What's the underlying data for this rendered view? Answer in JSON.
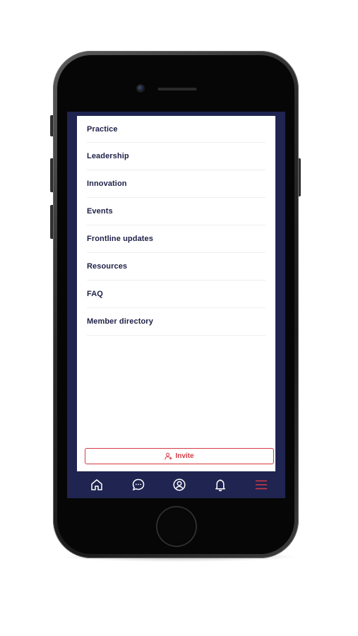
{
  "menu": {
    "items": [
      {
        "label": "Practice"
      },
      {
        "label": "Leadership"
      },
      {
        "label": "Innovation"
      },
      {
        "label": "Events"
      },
      {
        "label": "Frontline updates"
      },
      {
        "label": "Resources"
      },
      {
        "label": "FAQ"
      },
      {
        "label": "Member directory"
      }
    ]
  },
  "invite": {
    "label": "Invite",
    "icon": "user-plus-icon"
  },
  "tab_bar": {
    "tabs": [
      {
        "icon": "home-icon"
      },
      {
        "icon": "chat-bubble-icon"
      },
      {
        "icon": "profile-icon"
      },
      {
        "icon": "bell-icon"
      },
      {
        "icon": "hamburger-menu-icon",
        "active": true
      }
    ]
  },
  "colors": {
    "navy": "#1f2450",
    "accent_red": "#d33a44",
    "menu_text": "#1e2046",
    "icon_white": "#ffffff"
  }
}
